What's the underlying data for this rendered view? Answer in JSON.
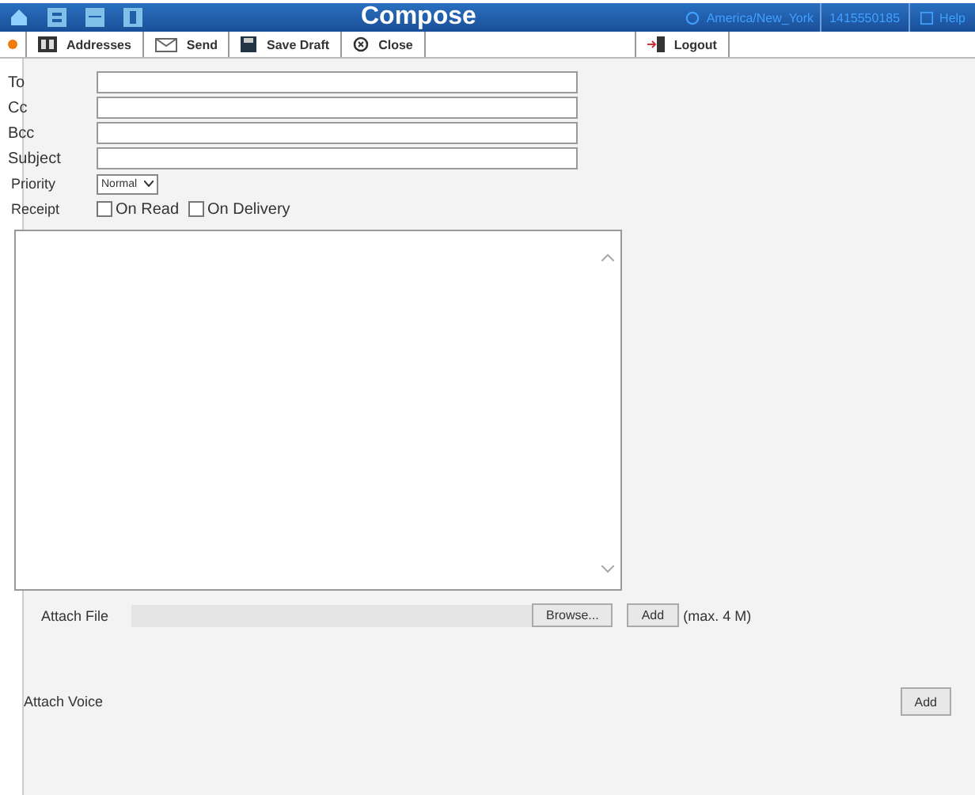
{
  "header": {
    "title": "Compose",
    "timezone": "America/New_York",
    "account": "1415550185",
    "help": "Help"
  },
  "toolbar": [
    {
      "kind": "marker"
    },
    {
      "kind": "button",
      "label": "Addresses"
    },
    {
      "kind": "button",
      "label": "Send"
    },
    {
      "kind": "button",
      "label": "Save Draft"
    },
    {
      "kind": "button",
      "label": "Close"
    },
    {
      "kind": "spacer"
    },
    {
      "kind": "button",
      "label": "Logout"
    }
  ],
  "fields": [
    {
      "label": "To"
    },
    {
      "label": "Cc"
    },
    {
      "label": "Bcc"
    },
    {
      "label": "Subject"
    }
  ],
  "priority": {
    "label": "Priority",
    "value": "Normal"
  },
  "receipt": {
    "label": "Receipt",
    "options": [
      {
        "label": "On Read",
        "checked": false
      },
      {
        "label": "On Delivery",
        "checked": false
      }
    ]
  },
  "attach_file": {
    "label": "Attach File",
    "browse": "Browse...",
    "add": "Add",
    "note": "(max. 4 M)"
  },
  "attach_voice": {
    "label": "Attach Voice",
    "add": "Add"
  }
}
